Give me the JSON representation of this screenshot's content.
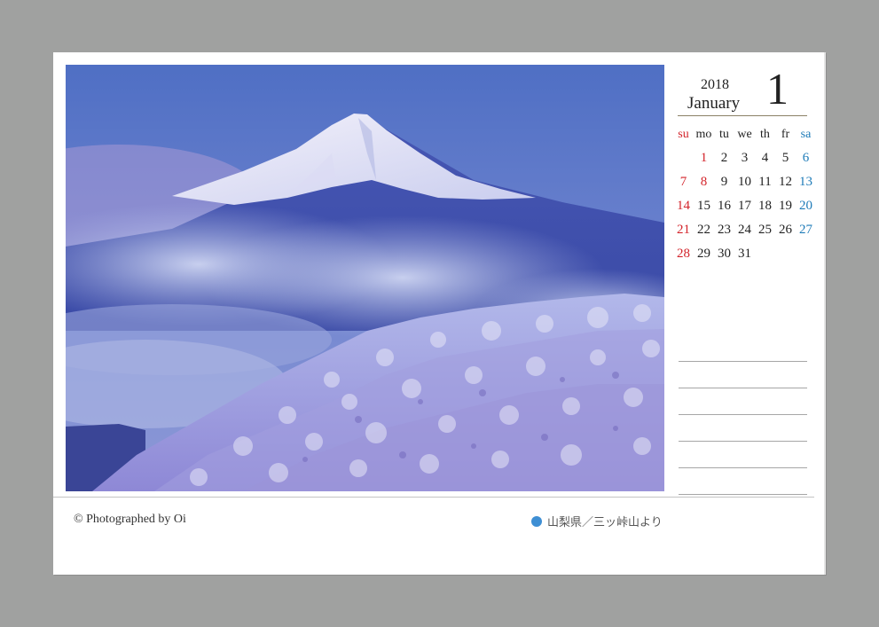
{
  "calendar": {
    "year": "2018",
    "month_name": "January",
    "month_number": "1",
    "weekdays": [
      "su",
      "mo",
      "tu",
      "we",
      "th",
      "fr",
      "sa"
    ],
    "weeks": [
      [
        "",
        "1",
        "2",
        "3",
        "4",
        "5",
        "6"
      ],
      [
        "7",
        "8",
        "9",
        "10",
        "11",
        "12",
        "13"
      ],
      [
        "14",
        "15",
        "16",
        "17",
        "18",
        "19",
        "20"
      ],
      [
        "21",
        "22",
        "23",
        "24",
        "25",
        "26",
        "27"
      ],
      [
        "28",
        "29",
        "30",
        "31",
        "",
        "",
        ""
      ]
    ],
    "holidays": [
      "1",
      "8"
    ]
  },
  "footer": {
    "credit": "© Photographed by Oi",
    "location": "山梨県／三ッ峠山より"
  },
  "photo": {
    "icon": "mount-fuji-winter-photo"
  },
  "colors": {
    "sunday": "#d3232a",
    "saturday": "#1e7bb8",
    "location_dot": "#3e8fd4",
    "header_rule": "#8a8066"
  }
}
